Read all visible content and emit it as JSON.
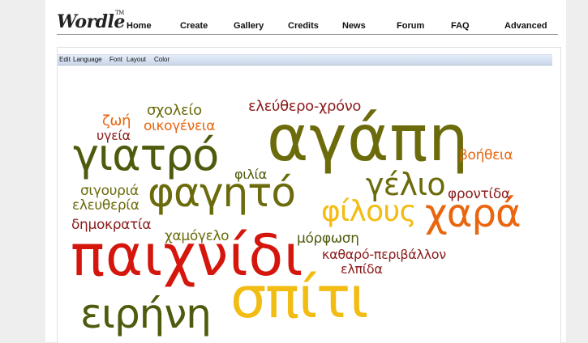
{
  "logo": {
    "text": "Wordle",
    "trademark": "TM"
  },
  "nav": {
    "items": [
      "Home",
      "Create",
      "Gallery",
      "Credits",
      "News",
      "Forum",
      "FAQ",
      "Advanced"
    ]
  },
  "menu": {
    "items": [
      "Edit",
      "Language",
      "Font",
      "Layout",
      "Color"
    ]
  },
  "palette": {
    "olive": "#6b6b0c",
    "dark_olive": "#4f5a0d",
    "red": "#d4160c",
    "orange": "#e9650e",
    "yellow": "#f2bc12",
    "maroon": "#8a1b1b"
  },
  "cloud": {
    "words": [
      {
        "text": "αγάπη",
        "color": "#6b6b0c"
      },
      {
        "text": "παιχνίδι",
        "color": "#d4160c"
      },
      {
        "text": "σπίτι",
        "color": "#f2bc12"
      },
      {
        "text": "γιατρό",
        "color": "#4f5a0d"
      },
      {
        "text": "φαγητό",
        "color": "#6b6b0c"
      },
      {
        "text": "ειρήνη",
        "color": "#4f5a0d"
      },
      {
        "text": "χαρά",
        "color": "#e9650e"
      },
      {
        "text": "φίλους",
        "color": "#f2bc12"
      },
      {
        "text": "γέλιο",
        "color": "#6b6b0c"
      },
      {
        "text": "ελεύθερο-χρόνο",
        "color": "#8a1b1b"
      },
      {
        "text": "σχολείο",
        "color": "#6b6b0c"
      },
      {
        "text": "ζωή",
        "color": "#e9650e"
      },
      {
        "text": "οικογένεια",
        "color": "#e9650e"
      },
      {
        "text": "υγεία",
        "color": "#8a1b1b"
      },
      {
        "text": "βοήθεια",
        "color": "#e9650e"
      },
      {
        "text": "φιλία",
        "color": "#4f5a0d"
      },
      {
        "text": "σιγουριά",
        "color": "#6b6b0c"
      },
      {
        "text": "ελευθερία",
        "color": "#6b6b0c"
      },
      {
        "text": "φροντίδα",
        "color": "#8a1b1b"
      },
      {
        "text": "δημοκρατία",
        "color": "#8a1b1b"
      },
      {
        "text": "χαμόγελο",
        "color": "#6b6b0c"
      },
      {
        "text": "μόρφωση",
        "color": "#4f5a0d"
      },
      {
        "text": "καθαρό-περιβάλλον",
        "color": "#8a1b1b"
      },
      {
        "text": "ελπίδα",
        "color": "#8a1b1b"
      }
    ]
  }
}
